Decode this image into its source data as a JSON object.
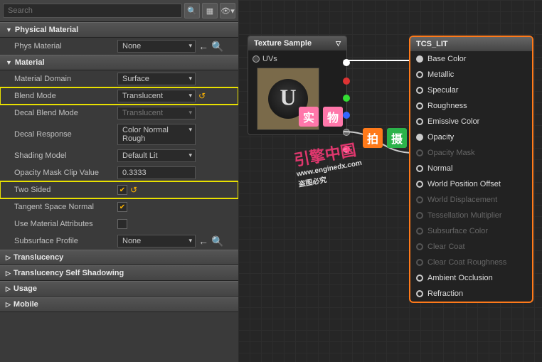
{
  "search": {
    "placeholder": "Search"
  },
  "sections": {
    "physMat": {
      "title": "Physical Material",
      "phys_label": "Phys Material",
      "phys_value": "None"
    },
    "material": {
      "title": "Material",
      "domain_label": "Material Domain",
      "domain_value": "Surface",
      "blend_label": "Blend Mode",
      "blend_value": "Translucent",
      "decalBlend_label": "Decal Blend Mode",
      "decalBlend_value": "Translucent",
      "decalResp_label": "Decal Response",
      "decalResp_value": "Color Normal Rough",
      "shading_label": "Shading Model",
      "shading_value": "Default Lit",
      "opMask_label": "Opacity Mask Clip Value",
      "opMask_value": "0.3333",
      "twoSided_label": "Two Sided",
      "tangent_label": "Tangent Space Normal",
      "useAttr_label": "Use Material Attributes",
      "subsurf_label": "Subsurface Profile",
      "subsurf_value": "None"
    },
    "translucency": {
      "title": "Translucency"
    },
    "selfShadow": {
      "title": "Translucency Self Shadowing"
    },
    "usage": {
      "title": "Usage"
    },
    "mobile": {
      "title": "Mobile"
    }
  },
  "texNode": {
    "title": "Texture Sample",
    "uvs": "UVs"
  },
  "outNode": {
    "title": "TCS_LIT",
    "pins": [
      {
        "name": "Base Color",
        "filled": true,
        "dim": false
      },
      {
        "name": "Metallic",
        "filled": false,
        "dim": false
      },
      {
        "name": "Specular",
        "filled": false,
        "dim": false
      },
      {
        "name": "Roughness",
        "filled": false,
        "dim": false
      },
      {
        "name": "Emissive Color",
        "filled": false,
        "dim": false
      },
      {
        "name": "Opacity",
        "filled": true,
        "dim": false
      },
      {
        "name": "Opacity Mask",
        "filled": false,
        "dim": true
      },
      {
        "name": "Normal",
        "filled": false,
        "dim": false
      },
      {
        "name": "World Position Offset",
        "filled": false,
        "dim": false
      },
      {
        "name": "World Displacement",
        "filled": false,
        "dim": true
      },
      {
        "name": "Tessellation Multiplier",
        "filled": false,
        "dim": true
      },
      {
        "name": "Subsurface Color",
        "filled": false,
        "dim": true
      },
      {
        "name": "Clear Coat",
        "filled": false,
        "dim": true
      },
      {
        "name": "Clear Coat Roughness",
        "filled": false,
        "dim": true
      },
      {
        "name": "Ambient Occlusion",
        "filled": false,
        "dim": false
      },
      {
        "name": "Refraction",
        "filled": false,
        "dim": false
      }
    ]
  },
  "watermark": {
    "text": "引擎中国",
    "url": "www.enginedx.com",
    "sub": "盗图必究"
  },
  "stamps": {
    "a": [
      "实",
      "物"
    ],
    "b": [
      "拍",
      "摄"
    ]
  }
}
